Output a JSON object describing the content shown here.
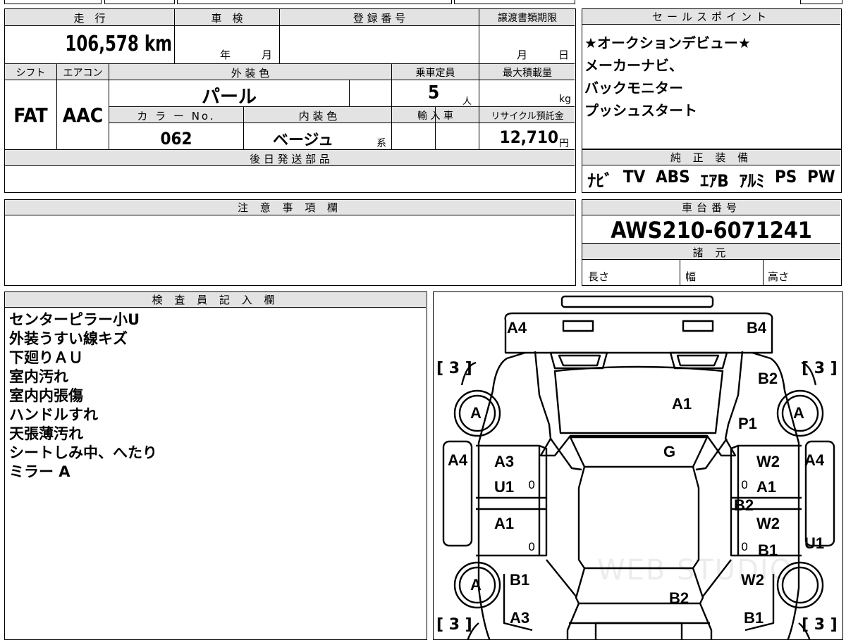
{
  "vehicle": {
    "mileage_label": "走　行",
    "mileage": "106,578 km",
    "inspection_label": "車　検",
    "inspection_year": "年",
    "inspection_month": "月",
    "registration_label": "登 録 番 号",
    "transfer_label": "譲渡書類期限",
    "transfer_month": "月",
    "transfer_day": "日",
    "shift_label": "シフト",
    "shift": "FAT",
    "ac_label": "エアコン",
    "ac": "AAC",
    "exterior_label": "外 装 色",
    "exterior": "パール",
    "capacity_label": "乗車定員",
    "capacity": "5",
    "capacity_unit": "人",
    "load_label": "最大積載量",
    "load_unit": "kg",
    "color_no_label": "カ ラ ー No.",
    "color_no": "062",
    "interior_label": "内 装 色",
    "interior": "ベージュ",
    "interior_suffix": "系",
    "import_label": "輸 入 車",
    "recycle_label": "リサイクル預託金",
    "recycle": "12,710",
    "recycle_unit": "円",
    "later_parts_label": "後 日 発 送 部 品"
  },
  "sales_points": {
    "label": "セールスポイント",
    "items": [
      "★オークションデビュー★",
      "メーカーナビ、",
      "バックモニター",
      "プッシュスタート"
    ]
  },
  "equipment": {
    "label": "純 正 装 備",
    "items": [
      "ﾅﾋﾞ",
      "TV",
      "ABS",
      "ｴｱB",
      "ｱﾙﾐ",
      "PS",
      "PW"
    ]
  },
  "notes_section": {
    "label": "注 意 事 項 欄"
  },
  "chassis": {
    "label": "車台番号",
    "number": "AWS210-6071241",
    "spec_label": "諸 元",
    "length": "長さ",
    "width": "幅",
    "height": "高さ"
  },
  "inspector": {
    "label": "検 査 員 記 入 欄",
    "lines": [
      "センターピラー小U",
      "外装うすい線キズ",
      "下廻りＡＵ",
      "室内汚れ",
      "室内内張傷",
      "ハンドルすれ",
      "天張薄汚れ",
      "シートしみ中、へたり",
      "ミラー A"
    ]
  },
  "diagram": {
    "tire_bracket": "[ 3 ]",
    "tire_grade": "A",
    "window_grade": "0",
    "watermark": "WEB STUDIO",
    "marks": {
      "a4_front_left": "A4",
      "b4_front_right": "B4",
      "b2_front_right": "B2",
      "a1_hood": "A1",
      "p1_right": "P1",
      "g_windshield": "G",
      "a4_left": "A4",
      "a3_left_door": "A3",
      "u1_left_door": "U1",
      "a1_left_rear": "A1",
      "w2_right_front": "W2",
      "a4_right": "A4",
      "a1_right_front": "A1",
      "b2_right_mid": "B2",
      "w2_right_rear": "W2",
      "b1_right_rear": "B1",
      "u1_right": "U1",
      "b1_left_bottom": "B1",
      "a3_left_bottom": "A3",
      "b2_bottom": "B2",
      "w2_right_bottom": "W2",
      "b1_right_bottom": "B1"
    }
  }
}
